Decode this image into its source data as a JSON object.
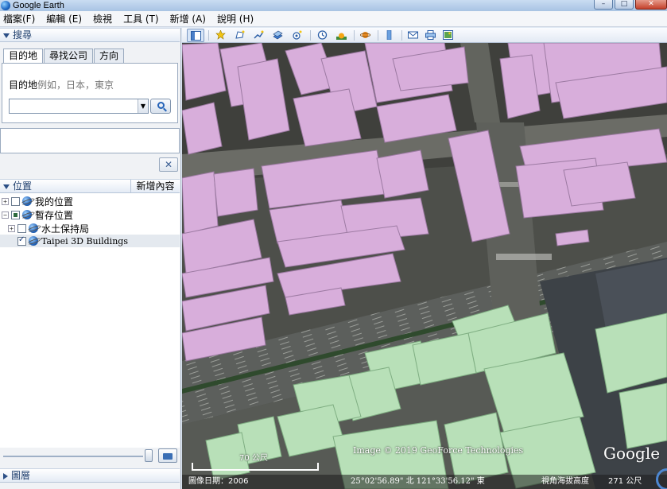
{
  "window": {
    "title": "Google Earth",
    "controls": [
      "–",
      "□",
      "✕"
    ]
  },
  "menu": {
    "items": [
      "檔案(F)",
      "編輯 (E)",
      "檢視",
      "工具 (T)",
      "新增 (A)",
      "說明 (H)"
    ]
  },
  "search": {
    "header": "搜尋",
    "tabs": [
      "目的地",
      "尋找公司",
      "方向"
    ],
    "label": "目的地",
    "hint": "例如，日本，東京",
    "input_value": "",
    "clear_label": "✕"
  },
  "places": {
    "header": "位置",
    "add_content": "新增內容",
    "items": [
      {
        "label": "我的位置",
        "expander": "+",
        "check": "none"
      },
      {
        "label": "暫存位置",
        "expander": "−",
        "check": "partial"
      },
      {
        "label": "水土保持局",
        "expander": "+",
        "check": "none"
      },
      {
        "label": "Taipei 3D Buildings",
        "expander": "",
        "check": "checked"
      }
    ]
  },
  "layers": {
    "header": "圖層"
  },
  "toolbar": {
    "icons": [
      "sidebar-icon",
      "placemark-icon",
      "polygon-icon",
      "path-icon",
      "overlay-icon",
      "tour-icon",
      "history-icon",
      "sun-icon",
      "planet-icon",
      "ruler-icon",
      "email-icon",
      "print-icon",
      "save-image-icon"
    ]
  },
  "map": {
    "scale": "70 公尺",
    "credit": "Image © 2019 GeoForce Technologies",
    "logo": "Google",
    "status": {
      "date": "圖像日期：2006",
      "coords": "25°02'56.89\" 北 121°33'56.12\" 東",
      "elev_label": "視角海拔高度",
      "eye_alt": "271 公尺"
    }
  }
}
